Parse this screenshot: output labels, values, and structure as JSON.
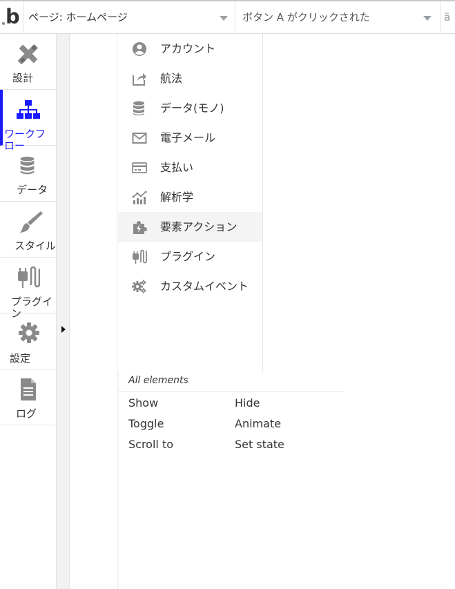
{
  "topbar": {
    "logo_text": "b",
    "page_selector": "ページ: ホームページ",
    "event_selector": "ボタン A がクリックされた",
    "third_selector": "ä"
  },
  "sidebar": {
    "items": [
      {
        "label": "設計",
        "icon": "design-pencil-ruler-icon"
      },
      {
        "label": "ワークフロー",
        "icon": "workflow-hierarchy-icon",
        "active": true
      },
      {
        "label": "データ",
        "icon": "database-icon"
      },
      {
        "label": "スタイル",
        "icon": "brush-icon"
      },
      {
        "label": "プラグイン",
        "icon": "plug-icon"
      },
      {
        "label": "設定",
        "icon": "gear-icon"
      },
      {
        "label": "ログ",
        "icon": "document-icon"
      }
    ]
  },
  "menu": {
    "items": [
      {
        "label": "アカウント",
        "icon": "account-icon"
      },
      {
        "label": "航法",
        "icon": "share-arrow-icon"
      },
      {
        "label": "データ(モノ)",
        "icon": "database-icon"
      },
      {
        "label": "電子メール",
        "icon": "envelope-icon"
      },
      {
        "label": "支払い",
        "icon": "credit-card-icon"
      },
      {
        "label": "解析学",
        "icon": "analytics-icon"
      },
      {
        "label": "要素アクション",
        "icon": "puzzle-icon"
      },
      {
        "label": "プラグイン",
        "icon": "plug-icon"
      },
      {
        "label": "カスタムイベント",
        "icon": "gears-icon"
      }
    ]
  },
  "submenu": {
    "heading": "All elements",
    "actions": [
      "Show",
      "Hide",
      "Toggle",
      "Animate",
      "Scroll to",
      "Set state"
    ]
  },
  "colors": {
    "accent": "#1a1aff",
    "icon_gray": "#888888",
    "text": "#333333"
  }
}
